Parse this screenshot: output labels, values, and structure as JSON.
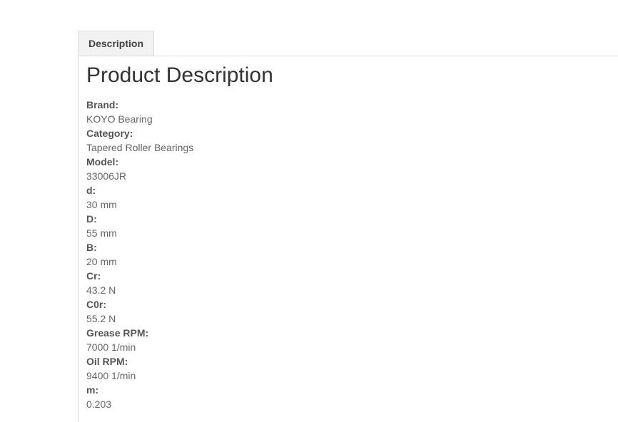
{
  "tabs": [
    {
      "label": "Description"
    }
  ],
  "content": {
    "title": "Product Description",
    "specs": [
      {
        "label": "Brand:",
        "value": "KOYO Bearing"
      },
      {
        "label": "Category:",
        "value": "Tapered Roller Bearings"
      },
      {
        "label": "Model:",
        "value": "33006JR"
      },
      {
        "label": "d:",
        "value": "30 mm"
      },
      {
        "label": "D:",
        "value": "55 mm"
      },
      {
        "label": "B:",
        "value": "20 mm"
      },
      {
        "label": "Cr:",
        "value": "43.2 N"
      },
      {
        "label": "C0r:",
        "value": "55.2 N"
      },
      {
        "label": "Grease RPM:",
        "value": "7000 1/min"
      },
      {
        "label": "Oil RPM:",
        "value": "9400 1/min"
      },
      {
        "label": "m:",
        "value": "0.203"
      }
    ]
  }
}
